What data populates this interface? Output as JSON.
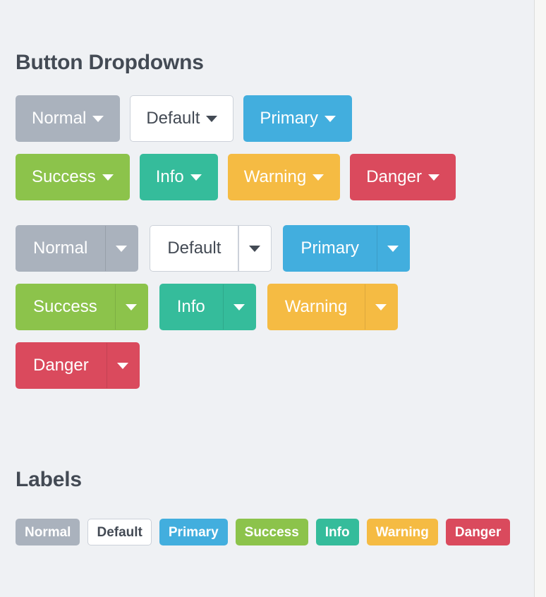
{
  "sections": {
    "dropdowns": {
      "title": "Button Dropdowns"
    },
    "labels": {
      "title": "Labels"
    }
  },
  "colors": {
    "page_background": "#eff1f4",
    "outer_background": "#f7f7f5",
    "heading": "#434a54",
    "normal": "#aab2bd",
    "default_bg": "#ffffff",
    "default_border": "#ccd1d9",
    "default_text": "#434a54",
    "primary": "#42aede",
    "success": "#8cc34b",
    "info": "#35bc9b",
    "warning": "#f5bb43",
    "danger": "#da4a5d"
  },
  "dropdown_buttons": [
    {
      "label": "Normal",
      "variant": "normal",
      "bg": "#aab2bd",
      "fg": "#ffffff"
    },
    {
      "label": "Default",
      "variant": "default",
      "bg": "#ffffff",
      "fg": "#434a54"
    },
    {
      "label": "Primary",
      "variant": "primary",
      "bg": "#42aede",
      "fg": "#ffffff"
    },
    {
      "label": "Success",
      "variant": "success",
      "bg": "#8cc34b",
      "fg": "#ffffff"
    },
    {
      "label": "Info",
      "variant": "info",
      "bg": "#35bc9b",
      "fg": "#ffffff"
    },
    {
      "label": "Warning",
      "variant": "warning",
      "bg": "#f5bb43",
      "fg": "#ffffff"
    },
    {
      "label": "Danger",
      "variant": "danger",
      "bg": "#da4a5d",
      "fg": "#ffffff"
    }
  ],
  "split_buttons": [
    {
      "label": "Normal",
      "variant": "normal",
      "bg": "#aab2bd",
      "fg": "#ffffff"
    },
    {
      "label": "Default",
      "variant": "default",
      "bg": "#ffffff",
      "fg": "#434a54"
    },
    {
      "label": "Primary",
      "variant": "primary",
      "bg": "#42aede",
      "fg": "#ffffff"
    },
    {
      "label": "Success",
      "variant": "success",
      "bg": "#8cc34b",
      "fg": "#ffffff"
    },
    {
      "label": "Info",
      "variant": "info",
      "bg": "#35bc9b",
      "fg": "#ffffff"
    },
    {
      "label": "Warning",
      "variant": "warning",
      "bg": "#f5bb43",
      "fg": "#ffffff"
    },
    {
      "label": "Danger",
      "variant": "danger",
      "bg": "#da4a5d",
      "fg": "#ffffff"
    }
  ],
  "labels": [
    {
      "label": "Normal",
      "variant": "normal",
      "bg": "#aab2bd",
      "fg": "#ffffff"
    },
    {
      "label": "Default",
      "variant": "default",
      "bg": "#ffffff",
      "fg": "#434a54"
    },
    {
      "label": "Primary",
      "variant": "primary",
      "bg": "#42aede",
      "fg": "#ffffff"
    },
    {
      "label": "Success",
      "variant": "success",
      "bg": "#8cc34b",
      "fg": "#ffffff"
    },
    {
      "label": "Info",
      "variant": "info",
      "bg": "#35bc9b",
      "fg": "#ffffff"
    },
    {
      "label": "Warning",
      "variant": "warning",
      "bg": "#f5bb43",
      "fg": "#ffffff"
    },
    {
      "label": "Danger",
      "variant": "danger",
      "bg": "#da4a5d",
      "fg": "#ffffff"
    }
  ],
  "icons": {
    "caret": "caret-down-icon"
  }
}
